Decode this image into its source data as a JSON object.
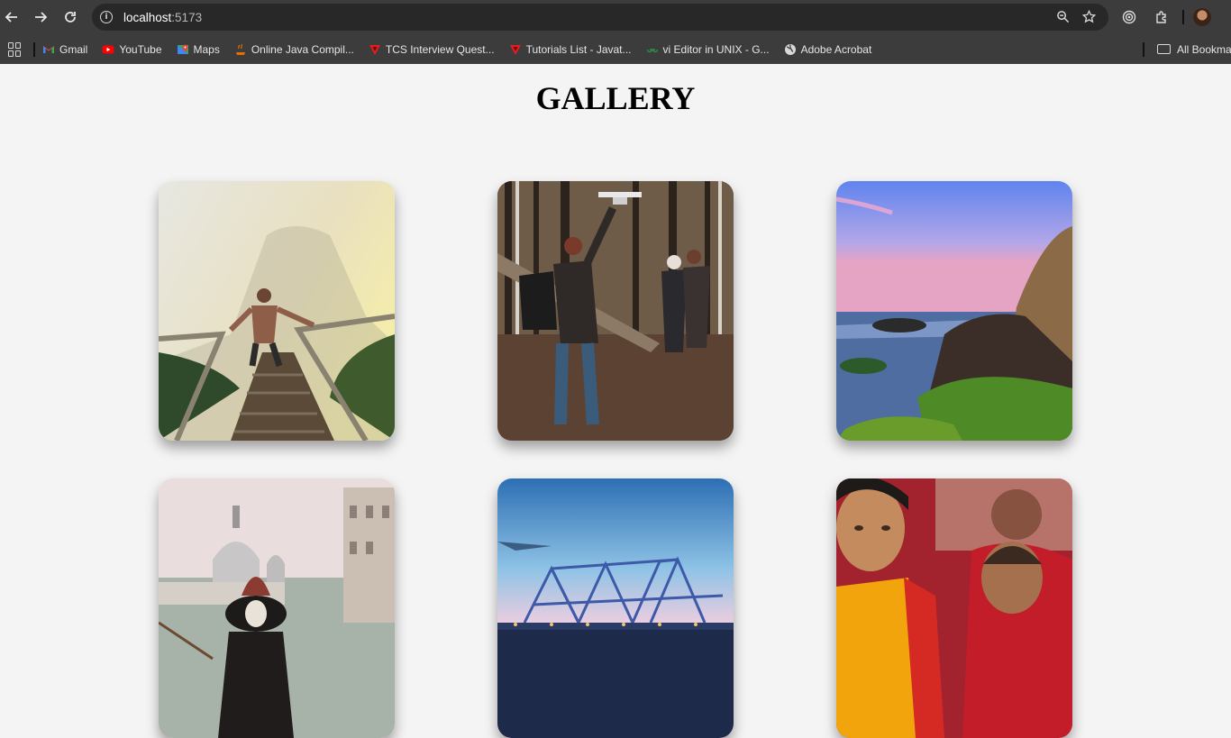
{
  "browser": {
    "url_host": "localhost",
    "url_port": ":5173"
  },
  "bookmarks": [
    {
      "label": "Gmail",
      "icon": "gmail-icon",
      "color": "#ea4335"
    },
    {
      "label": "YouTube",
      "icon": "youtube-icon",
      "color": "#ff0000"
    },
    {
      "label": "Maps",
      "icon": "maps-icon",
      "color": "#34a853"
    },
    {
      "label": "Online Java Compil...",
      "icon": "java-icon",
      "color": "#e76f00"
    },
    {
      "label": "TCS Interview Quest...",
      "icon": "javatpoint-icon",
      "color": "#e02020"
    },
    {
      "label": "Tutorials List - Javat...",
      "icon": "javatpoint-icon",
      "color": "#e02020"
    },
    {
      "label": "vi Editor in UNIX - G...",
      "icon": "geeksforgeeks-icon",
      "color": "#2f8d46"
    },
    {
      "label": "Adobe Acrobat",
      "icon": "globe-icon",
      "color": "#d8d8d8"
    }
  ],
  "all_bookmarks_label": "All Bookmar",
  "page": {
    "title": "GALLERY"
  },
  "gallery": [
    {
      "subject": "hiker on misty stairway"
    },
    {
      "subject": "man flying drone in forest"
    },
    {
      "subject": "rocky coast at sunset"
    },
    {
      "subject": "venice carnival mask"
    },
    {
      "subject": "howrah bridge at dusk"
    },
    {
      "subject": "young monks in red robes"
    }
  ]
}
